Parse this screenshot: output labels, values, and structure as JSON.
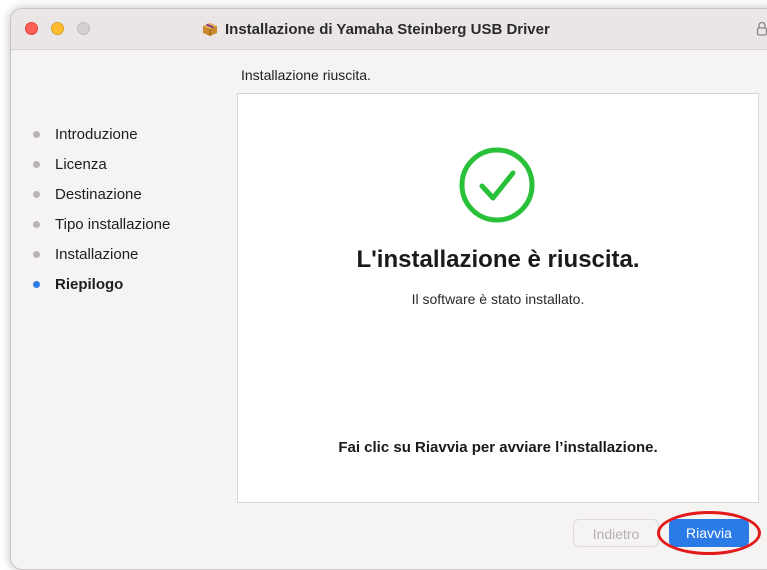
{
  "window": {
    "title": "Installazione di Yamaha Steinberg USB Driver"
  },
  "step_heading": "Installazione riuscita.",
  "sidebar": {
    "items": [
      {
        "label": "Introduzione",
        "active": false
      },
      {
        "label": "Licenza",
        "active": false
      },
      {
        "label": "Destinazione",
        "active": false
      },
      {
        "label": "Tipo installazione",
        "active": false
      },
      {
        "label": "Installazione",
        "active": false
      },
      {
        "label": "Riepilogo",
        "active": true
      }
    ]
  },
  "panel": {
    "title": "L'installazione è riuscita.",
    "subtitle": "Il software è stato installato.",
    "hint": "Fai clic su Riavvia per avviare l’installazione."
  },
  "buttons": {
    "back_label": "Indietro",
    "back_enabled": false,
    "restart_label": "Riavvia"
  },
  "colors": {
    "accent": "#2a7be6",
    "success": "#29c13a",
    "highlight": "#e21a1a"
  },
  "icons": {
    "title": "package-icon",
    "status": "checkmark-circle-icon",
    "lock": "lock-icon"
  }
}
